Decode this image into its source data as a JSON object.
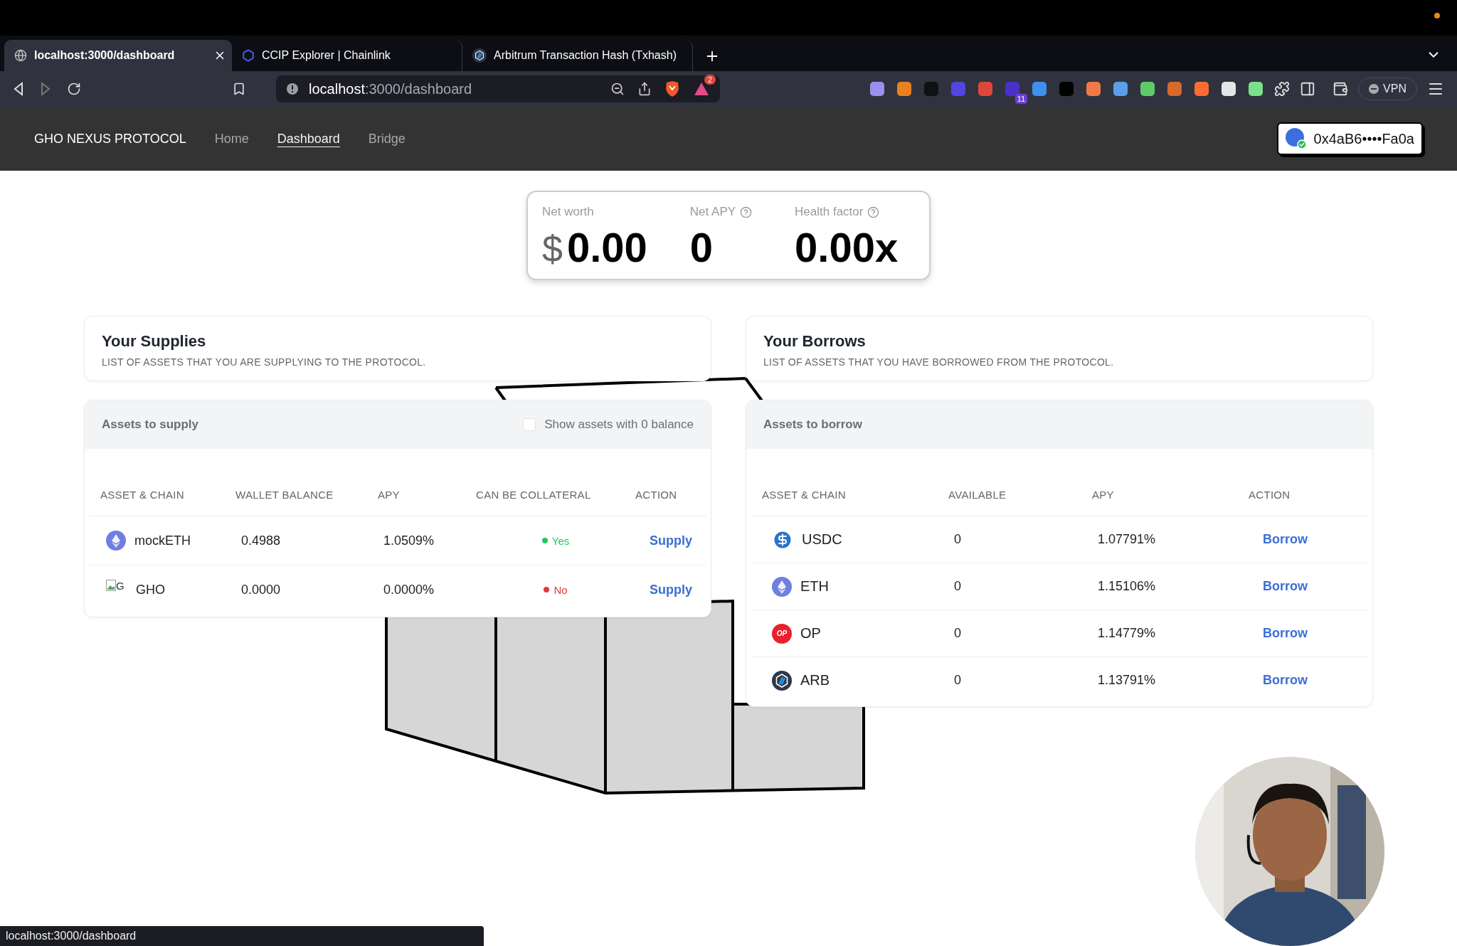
{
  "browser": {
    "tabs": [
      {
        "title": "localhost:3000/dashboard",
        "selected": true,
        "kind": "globe"
      },
      {
        "title": "CCIP Explorer | Chainlink",
        "selected": false,
        "kind": "hexagon"
      },
      {
        "title": "Arbitrum Transaction Hash (Txhash)",
        "selected": false,
        "kind": "arb"
      }
    ],
    "url": {
      "host": "localhost",
      "path": ":3000/dashboard"
    },
    "shield_badge": "2",
    "extension_badge": "11",
    "vpn": "VPN"
  },
  "nav": {
    "brand": "GHO NEXUS PROTOCOL",
    "links": [
      {
        "label": "Home",
        "selected": false
      },
      {
        "label": "Dashboard",
        "selected": true
      },
      {
        "label": "Bridge",
        "selected": false
      }
    ],
    "wallet": "0x4aB6••••Fa0a"
  },
  "stats": [
    {
      "label": "Net worth",
      "prefix": "$",
      "value": "0.00",
      "help": false
    },
    {
      "label": "Net APY",
      "value": "0",
      "help": true
    },
    {
      "label": "Health factor",
      "value": "0.00x",
      "help": true
    }
  ],
  "supplies": {
    "title": "Your Supplies",
    "subtitle": "LIST OF ASSETS THAT YOU ARE SUPPLYING TO THE PROTOCOL."
  },
  "borrows": {
    "title": "Your Borrows",
    "subtitle": "LIST OF ASSETS THAT YOU HAVE BORROWED FROM THE PROTOCOL."
  },
  "supply_table": {
    "title": "Assets to supply",
    "toggle": {
      "label": "Show assets with 0 balance",
      "checked": false
    },
    "columns": [
      "ASSET & CHAIN",
      "WALLET BALANCE",
      "APY",
      "CAN BE COLLATERAL",
      "ACTION"
    ],
    "rows": [
      {
        "asset": "mockETH",
        "kind": "eth",
        "balance": "0.4988",
        "apy": "1.0509%",
        "collateral": {
          "label": "Yes",
          "ok": true
        },
        "action": "Supply"
      },
      {
        "asset": "GHO",
        "kind": "broken",
        "icon_alt": "G",
        "balance": "0.0000",
        "apy": "0.0000%",
        "collateral": {
          "label": "No",
          "ok": false
        },
        "action": "Supply"
      }
    ]
  },
  "borrow_table": {
    "title": "Assets to borrow",
    "columns": [
      "ASSET & CHAIN",
      "AVAILABLE",
      "APY",
      "ACTION"
    ],
    "rows": [
      {
        "asset": "USDC",
        "kind": "usdc",
        "available": "0",
        "apy": "1.07791%",
        "action": "Borrow"
      },
      {
        "asset": "ETH",
        "kind": "eth",
        "available": "0",
        "apy": "1.15106%",
        "action": "Borrow"
      },
      {
        "asset": "OP",
        "kind": "op",
        "logo_text": "OP",
        "available": "0",
        "apy": "1.14779%",
        "action": "Borrow"
      },
      {
        "asset": "ARB",
        "kind": "arb",
        "available": "0",
        "apy": "1.13791%",
        "action": "Borrow"
      }
    ]
  },
  "status_bar": "localhost:3000/dashboard"
}
